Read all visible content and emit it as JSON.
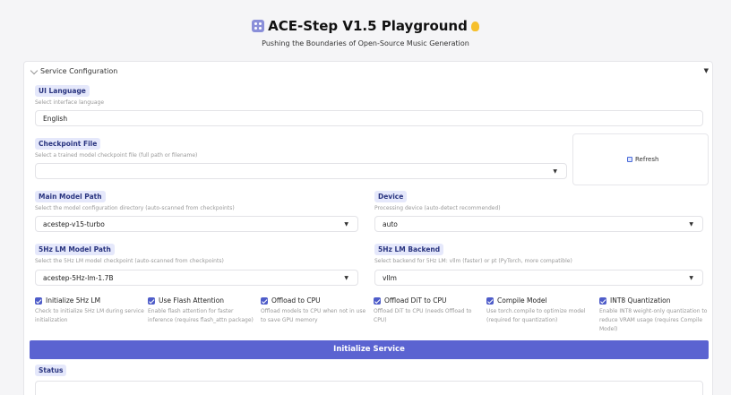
{
  "header": {
    "title": "ACE-Step V1.5 Playground",
    "subtitle": "Pushing the Boundaries of Open-Source Music Generation"
  },
  "accordion": {
    "title": "Service Configuration",
    "caret": "▼"
  },
  "ui_language": {
    "label": "UI Language",
    "hint": "Select interface language",
    "value": "English"
  },
  "checkpoint": {
    "label": "Checkpoint File",
    "hint": "Select a trained model checkpoint file (full path or filename)",
    "value": ""
  },
  "refresh": {
    "label": "Refresh"
  },
  "main_model": {
    "label": "Main Model Path",
    "hint": "Select the model configuration directory (auto-scanned from checkpoints)",
    "value": "acestep-v15-turbo"
  },
  "device": {
    "label": "Device",
    "hint": "Processing device (auto-detect recommended)",
    "value": "auto"
  },
  "lm_model": {
    "label": "5Hz LM Model Path",
    "hint": "Select the 5Hz LM model checkpoint (auto-scanned from checkpoints)",
    "value": "acestep-5Hz-lm-1.7B"
  },
  "lm_backend": {
    "label": "5Hz LM Backend",
    "hint": "Select backend for 5Hz LM: vllm (faster) or pt (PyTorch, more compatible)",
    "value": "vllm"
  },
  "checkboxes": [
    {
      "label": "Initialize 5Hz LM",
      "desc": "Check to initialize 5Hz LM during service initialization",
      "checked": true
    },
    {
      "label": "Use Flash Attention",
      "desc": "Enable flash attention for faster inference (requires flash_attn package)",
      "checked": true
    },
    {
      "label": "Offload to CPU",
      "desc": "Offload models to CPU when not in use to save GPU memory",
      "checked": true
    },
    {
      "label": "Offload DiT to CPU",
      "desc": "Offload DiT to CPU (needs Offload to CPU)",
      "checked": true
    },
    {
      "label": "Compile Model",
      "desc": "Use torch.compile to optimize model (required for quantization)",
      "checked": true
    },
    {
      "label": "INT8 Quantization",
      "desc": "Enable INT8 weight-only quantization to reduce VRAM usage (requires Compile Model)",
      "checked": true
    }
  ],
  "init_button": {
    "label": "Initialize Service"
  },
  "status": {
    "label": "Status",
    "value": ""
  },
  "colors": {
    "accent": "#5b63d1",
    "label_bg": "#e5e8fb",
    "label_text": "#2a3580"
  }
}
